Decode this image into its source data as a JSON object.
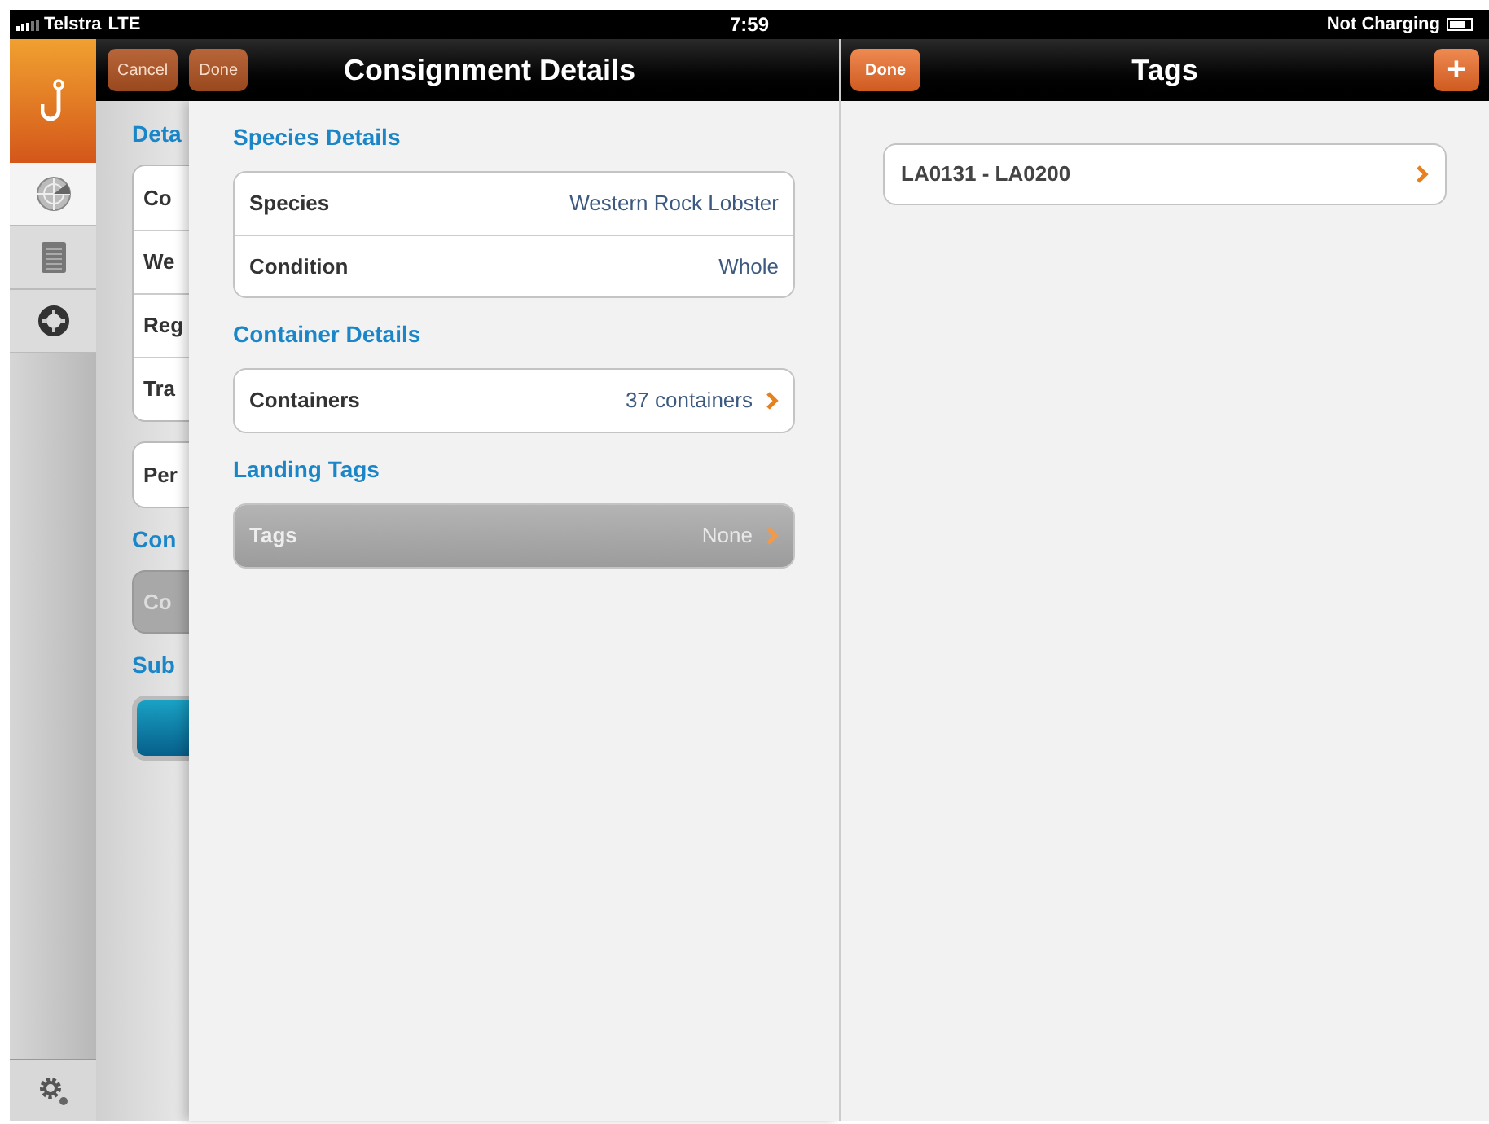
{
  "status_bar": {
    "carrier": "Telstra",
    "network": "LTE",
    "time": "7:59",
    "battery_text": "Not Charging"
  },
  "sidebar": {
    "items": [
      {
        "kind": "radar",
        "selected": true
      },
      {
        "kind": "notes",
        "selected": false
      },
      {
        "kind": "lifebuoy",
        "selected": false
      }
    ]
  },
  "background_form": {
    "nav_buttons": [
      {
        "label": "Cancel",
        "disabled": true
      },
      {
        "label": "Done",
        "disabled": true
      }
    ],
    "blocks": [
      {
        "kind": "header",
        "text": "Deta"
      },
      {
        "kind": "group",
        "rows": [
          "Co",
          "We",
          "Reg",
          "Tra"
        ]
      },
      {
        "kind": "group",
        "rows": [
          "Per"
        ]
      },
      {
        "kind": "header",
        "text": "Con"
      },
      {
        "kind": "gray_button",
        "text": "Co"
      },
      {
        "kind": "header",
        "text": "Sub"
      },
      {
        "kind": "teal_button"
      }
    ]
  },
  "consignment_details": {
    "title": "Consignment Details",
    "sections": [
      {
        "title": "Species Details",
        "rows": [
          {
            "label": "Species",
            "value": "Western Rock Lobster",
            "disclosure": false,
            "selected": false
          },
          {
            "label": "Condition",
            "value": "Whole",
            "disclosure": false,
            "selected": false
          }
        ]
      },
      {
        "title": "Container Details",
        "rows": [
          {
            "label": "Containers",
            "value": "37 containers",
            "disclosure": true,
            "selected": false
          }
        ]
      },
      {
        "title": "Landing Tags",
        "rows": [
          {
            "label": "Tags",
            "value": "None",
            "disclosure": true,
            "selected": true
          }
        ]
      }
    ]
  },
  "tags_panel": {
    "done_button": "Done",
    "title": "Tags",
    "add_button": "+",
    "items": [
      {
        "label": "LA0131 - LA0200",
        "disclosure": true
      }
    ]
  }
}
